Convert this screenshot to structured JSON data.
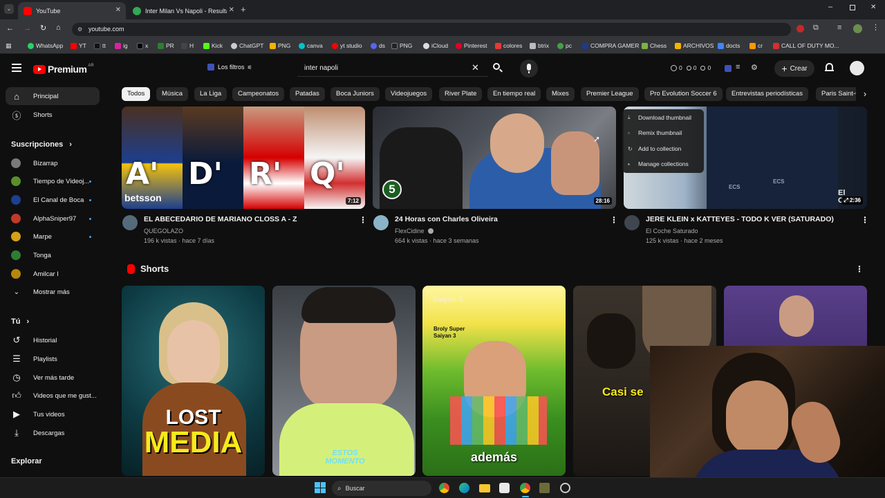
{
  "browser": {
    "tabs": [
      {
        "label": "YouTube",
        "active": true
      },
      {
        "label": "Inter Milan Vs Napoli - Resultad",
        "active": false
      }
    ],
    "url": "youtube.com",
    "bookmarks": [
      "WhatsApp",
      "YT",
      "tt",
      "ig",
      "x",
      "PR",
      "H",
      "Kick",
      "ChatGPT",
      "PNG",
      "canva",
      "yt studio",
      "ds",
      "PNG",
      "iCloud",
      "Pinterest",
      "colores",
      "btrix",
      "pc",
      "COMPRA GAMER",
      "Chess",
      "ARCHIVOS",
      "docts",
      "cr",
      "CALL OF DUTY MO..."
    ]
  },
  "masthead": {
    "logo_text": "Premium",
    "country": "AR",
    "filters_label": "Los filtros",
    "search_value": "inter napoli",
    "counters": [
      "0",
      "0",
      "0"
    ],
    "create_label": "Crear"
  },
  "chips": [
    "Todos",
    "Música",
    "La Liga",
    "Campeonatos",
    "Patadas",
    "Boca Juniors",
    "Videojuegos",
    "River Plate",
    "En tiempo real",
    "Mixes",
    "Premier League",
    "Pro Evolution Soccer 6",
    "Entrevistas periodísticas",
    "Paris Saint-G"
  ],
  "sidebar": {
    "main": [
      {
        "label": "Principal",
        "icon": "home-icon"
      },
      {
        "label": "Shorts",
        "icon": "shorts-icon"
      }
    ],
    "subscriptions_title": "Suscripciones",
    "subscriptions": [
      {
        "label": "Bizarrap",
        "color": "#7a7a7a",
        "dot": false
      },
      {
        "label": "Tiempo de Videoj...",
        "color": "#5a8f2a",
        "dot": true
      },
      {
        "label": "El Canal de Boca",
        "color": "#1d3f8f",
        "dot": true
      },
      {
        "label": "AlphaSniper97",
        "color": "#c0392b",
        "dot": true
      },
      {
        "label": "Marpe",
        "color": "#d4a017",
        "dot": true
      },
      {
        "label": "Tonga",
        "color": "#2e7d32",
        "dot": false
      },
      {
        "label": "Amilcar I",
        "color": "#b8860b",
        "dot": false
      }
    ],
    "show_more": "Mostrar más",
    "you_title": "Tú",
    "you_items": [
      {
        "label": "Historial",
        "icon": "history-icon"
      },
      {
        "label": "Playlists",
        "icon": "playlists-icon"
      },
      {
        "label": "Ver más tarde",
        "icon": "watch-later-icon"
      },
      {
        "label": "Videos que me gust...",
        "icon": "like-icon"
      },
      {
        "label": "Tus videos",
        "icon": "your-videos-icon"
      },
      {
        "label": "Descargas",
        "icon": "download-icon"
      }
    ],
    "explore_title": "Explorar"
  },
  "videos": [
    {
      "title": "EL ABECEDARIO DE MARIANO CLOSS A - Z",
      "channel": "QUEGOLAZO",
      "meta": "196 k vistas · hace 7 días",
      "duration": "7:12",
      "verified": false
    },
    {
      "title": "24 Horas con Charles Oliveira",
      "channel": "FlexCidine",
      "meta": "664 k vistas · hace 3 semanas",
      "duration": "28:16",
      "verified": true
    },
    {
      "title": "JERE KLEIN x KATTEYES - TODO K VER (SATURADO)",
      "channel": "El Coche Saturado",
      "meta": "125 k vistas · hace 2 meses",
      "duration": "2:36",
      "verified": false
    }
  ],
  "thumb_text": {
    "letters": [
      "A'",
      "D'",
      "R'",
      "Q'"
    ],
    "sponsor": "betsson",
    "badge": "5",
    "speakers": [
      "ECS",
      "ECS"
    ],
    "corner": "El Coche"
  },
  "context_menu": [
    "Download thumbnail",
    "Remix thumbnail",
    "Add to collection",
    "Manage collections"
  ],
  "shorts": {
    "title": "Shorts",
    "items": [
      {
        "line1": "LOST",
        "line2": "MEDIA"
      },
      {
        "caption": "ESTOS MOMENTO"
      },
      {
        "caption": "además",
        "top_text": "Broly Super Saiyan 3",
        "header": "Saiyan 3"
      },
      {
        "caption": "Casi se"
      },
      {
        "caption": ""
      }
    ]
  },
  "taskbar": {
    "search_label": "Buscar"
  }
}
